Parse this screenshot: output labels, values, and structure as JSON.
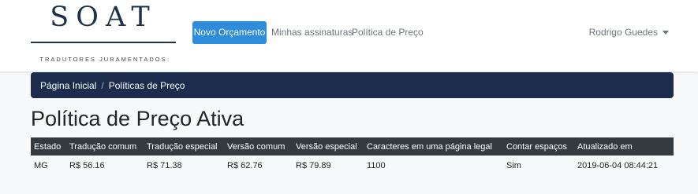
{
  "brand": {
    "name": "SOAT",
    "tagline": "TRADUTORES JURAMENTADOS"
  },
  "nav": {
    "primary_button": "Novo Orçamento",
    "links": [
      "Minhas assinaturas",
      "Política de Preço"
    ],
    "user_name": "Rodrigo Guedes"
  },
  "breadcrumb": {
    "home": "Página Inicial",
    "current": "Políticas de Preço"
  },
  "page": {
    "title": "Política de Preço Ativa"
  },
  "table": {
    "headers": [
      "Estado",
      "Tradução comum",
      "Tradução especial",
      "Versão comum",
      "Versão especial",
      "Caracteres em uma página legal",
      "Contar espaços",
      "Atualizado em"
    ],
    "rows": [
      [
        "MG",
        "R$ 56.16",
        "R$ 71.38",
        "R$ 62.76",
        "R$ 79.89",
        "1100",
        "Sim",
        "2019-06-04 08:44:21"
      ]
    ]
  },
  "colors": {
    "primary": "#2e8cdc",
    "breadcrumb_bg": "#1d2c4d",
    "table_header_bg": "#343a40",
    "logo": "#1e3146"
  }
}
